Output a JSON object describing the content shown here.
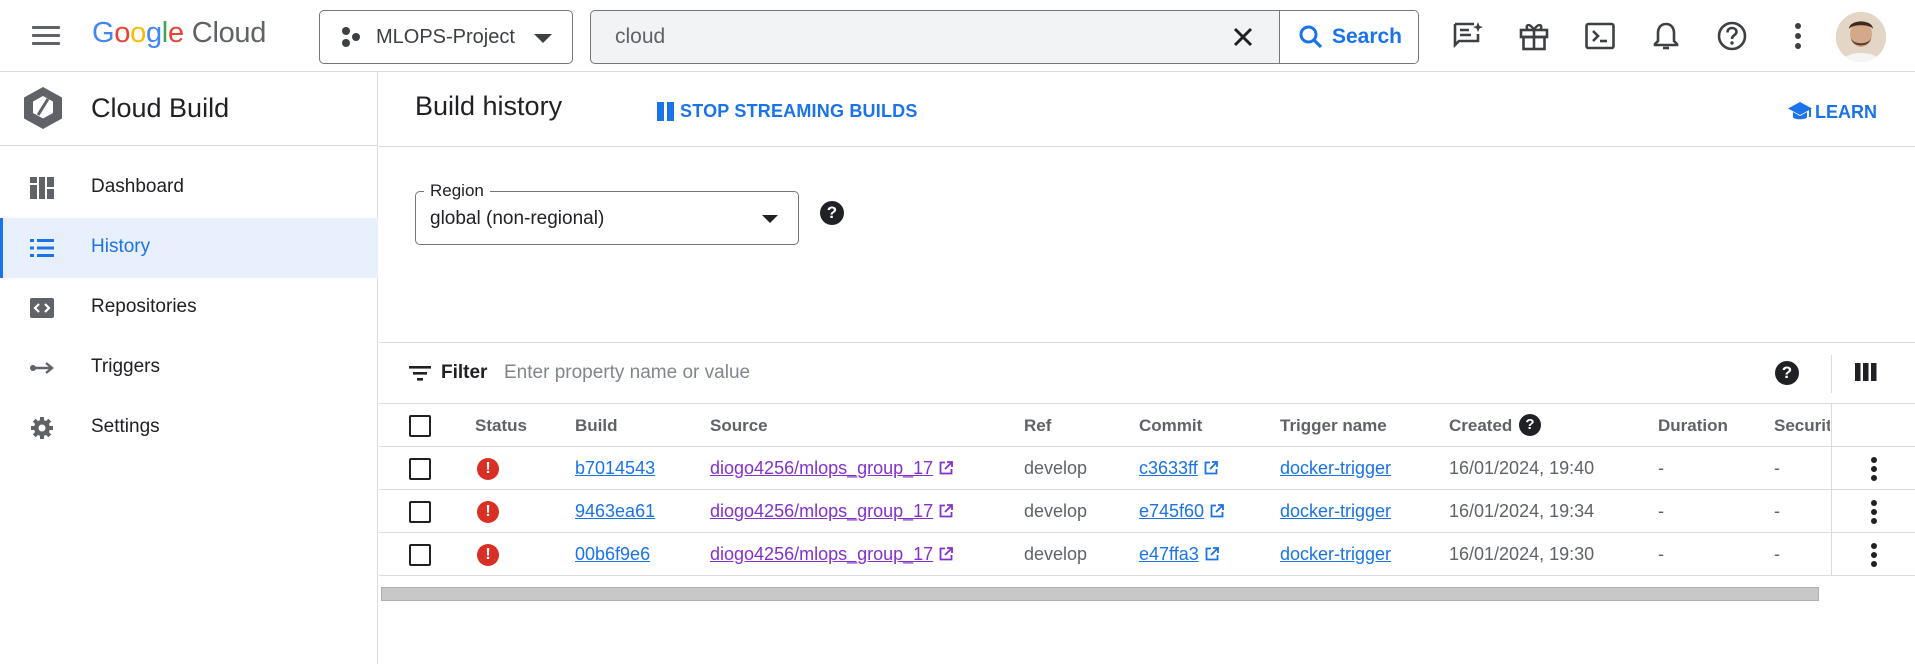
{
  "topbar": {
    "brand_letters": [
      "G",
      "o",
      "o",
      "g",
      "l",
      "e"
    ],
    "brand_suffix": "Cloud",
    "project_name": "MLOPS-Project",
    "search_value": "cloud",
    "search_button": "Search",
    "icons": [
      "menu-icon",
      "notes-icon",
      "gift-icon",
      "terminal-icon",
      "bell-icon",
      "help-icon",
      "more-vert-icon",
      "avatar"
    ]
  },
  "sidebar": {
    "product_name": "Cloud Build",
    "items": [
      {
        "label": "Dashboard",
        "icon": "dashboard-icon"
      },
      {
        "label": "History",
        "icon": "list-icon",
        "active": true
      },
      {
        "label": "Repositories",
        "icon": "code-icon"
      },
      {
        "label": "Triggers",
        "icon": "arrow-icon"
      },
      {
        "label": "Settings",
        "icon": "gear-icon"
      }
    ]
  },
  "header": {
    "title": "Build history",
    "stop_label": "STOP STREAMING BUILDS",
    "learn_label": "LEARN"
  },
  "region": {
    "label": "Region",
    "value": "global (non-regional)"
  },
  "filter": {
    "label": "Filter",
    "placeholder": "Enter property name or value"
  },
  "table": {
    "columns": [
      "Status",
      "Build",
      "Source",
      "Ref",
      "Commit",
      "Trigger name",
      "Created",
      "Duration",
      "Securit"
    ],
    "rows": [
      {
        "status": "error",
        "build": "b7014543",
        "source": "diogo4256/mlops_group_17",
        "ref": "develop",
        "commit": "c3633ff",
        "trigger": "docker-trigger",
        "created": "16/01/2024, 19:40",
        "duration": "-",
        "security": "-"
      },
      {
        "status": "error",
        "build": "9463ea61",
        "source": "diogo4256/mlops_group_17",
        "ref": "develop",
        "commit": "e745f60",
        "trigger": "docker-trigger",
        "created": "16/01/2024, 19:34",
        "duration": "-",
        "security": "-"
      },
      {
        "status": "error",
        "build": "00b6f9e6",
        "source": "diogo4256/mlops_group_17",
        "ref": "develop",
        "commit": "e47ffa3",
        "trigger": "docker-trigger",
        "created": "16/01/2024, 19:30",
        "duration": "-",
        "security": "-"
      }
    ]
  },
  "colors": {
    "accent": "#1a73e8",
    "error": "#d93025",
    "visited_link": "#8430ce"
  }
}
